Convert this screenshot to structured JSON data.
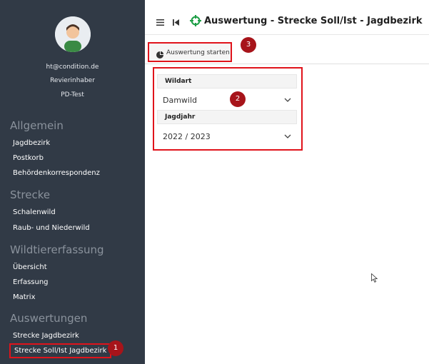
{
  "sidebar": {
    "user": {
      "email": "ht@condition.de",
      "role": "Revierinhaber",
      "account": "PD-Test"
    },
    "sections": {
      "allgemein": {
        "title": "Allgemein",
        "items": [
          "Jagdbezirk",
          "Postkorb",
          "Behördenkorrespondenz"
        ]
      },
      "strecke": {
        "title": "Strecke",
        "items": [
          "Schalenwild",
          "Raub- und Niederwild"
        ]
      },
      "wildtiererfassung": {
        "title": "Wildtiererfassung",
        "items": [
          "Übersicht",
          "Erfassung",
          "Matrix"
        ]
      },
      "auswertungen": {
        "title": "Auswertungen",
        "items": [
          "Strecke Jagdbezirk",
          "Strecke Soll/Ist Jagdbezirk"
        ]
      }
    }
  },
  "header": {
    "title": "Auswertung - Strecke Soll/Ist - Jagdbezirk",
    "menu_icon": "hamburger-icon",
    "back_icon": "skip-back-icon",
    "logo_icon": "crosshair-icon"
  },
  "toolbar": {
    "start_label": "Auswertung starten",
    "start_icon": "pie-chart-icon"
  },
  "form": {
    "wildart": {
      "label": "Wildart",
      "value": "Damwild"
    },
    "jagdjahr": {
      "label": "Jagdjahr",
      "value": "2022 / 2023"
    }
  },
  "badges": [
    "1",
    "2",
    "3"
  ],
  "colors": {
    "sidebar_bg": "#313a46",
    "highlight": "#e0131b",
    "badge": "#a7141a",
    "logo": "#1e9e46"
  }
}
